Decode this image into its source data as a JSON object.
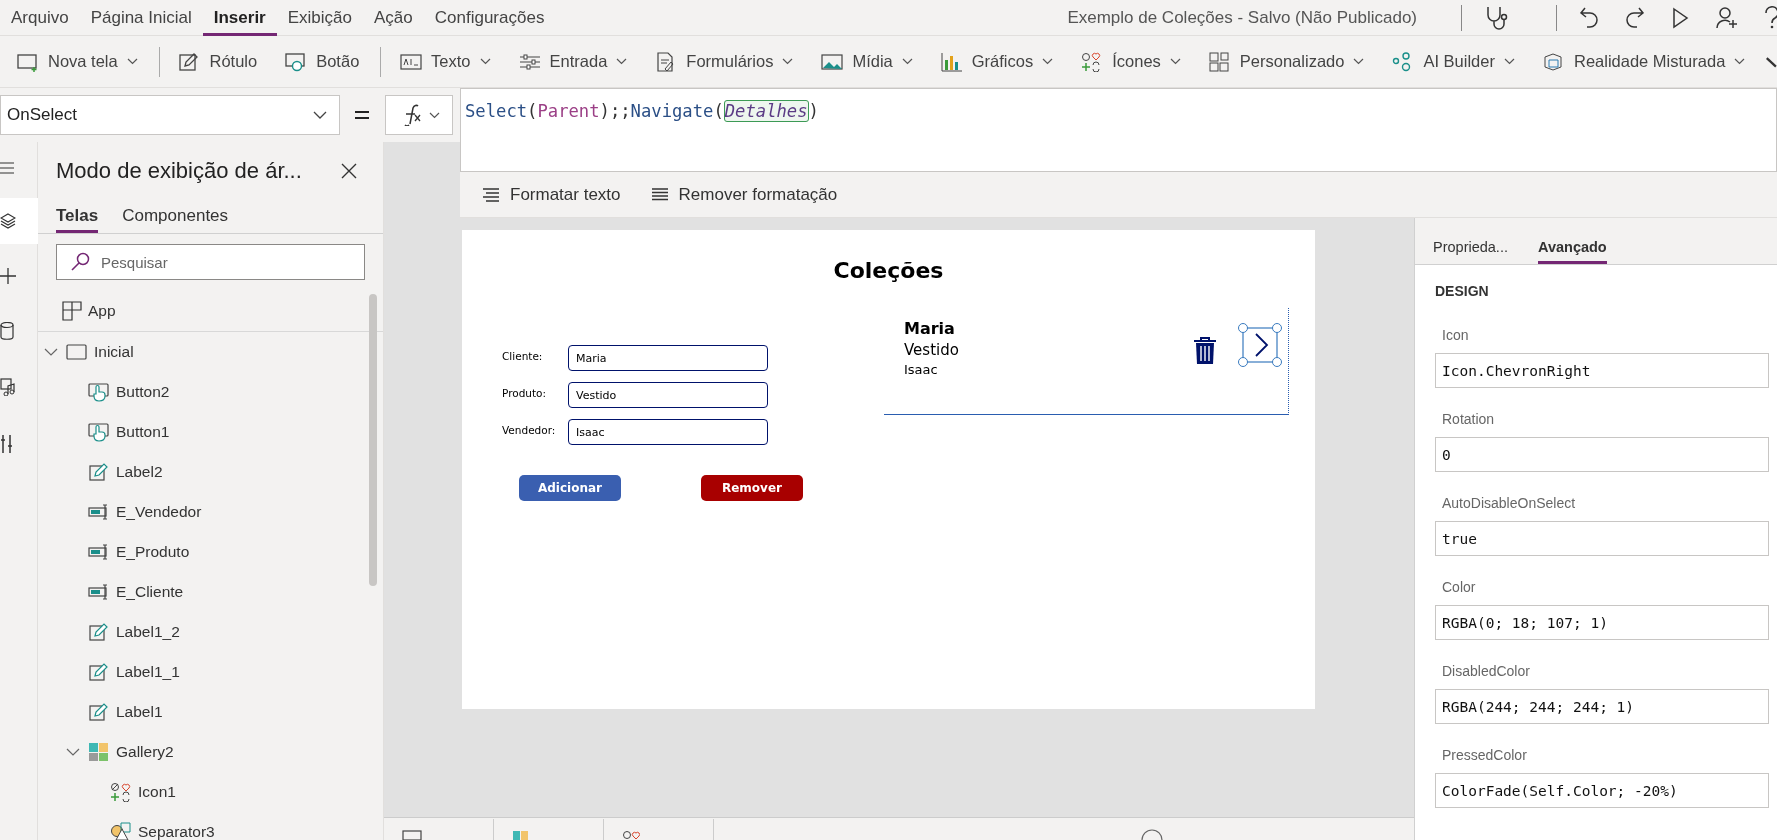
{
  "menu": [
    {
      "label": "Arquivo",
      "selected": false
    },
    {
      "label": "Página Inicial",
      "selected": false
    },
    {
      "label": "Inserir",
      "selected": true
    },
    {
      "label": "Exibição",
      "selected": false
    },
    {
      "label": "Ação",
      "selected": false
    },
    {
      "label": "Configurações",
      "selected": false
    }
  ],
  "document_title": "Exemplo de Coleções - Salvo (Não Publicado)",
  "toolbar": [
    {
      "label": "Nova tela",
      "kind": "new-screen",
      "dropdown": true,
      "divider_after": true
    },
    {
      "label": "Rótulo",
      "kind": "label",
      "dropdown": false,
      "divider_after": false
    },
    {
      "label": "Botão",
      "kind": "button",
      "dropdown": false,
      "divider_after": true
    },
    {
      "label": "Texto",
      "kind": "text",
      "dropdown": true,
      "divider_after": false
    },
    {
      "label": "Entrada",
      "kind": "input",
      "dropdown": true,
      "divider_after": false
    },
    {
      "label": "Formulários",
      "kind": "forms",
      "dropdown": true,
      "divider_after": false
    },
    {
      "label": "Mídia",
      "kind": "media",
      "dropdown": true,
      "divider_after": false
    },
    {
      "label": "Gráficos",
      "kind": "charts",
      "dropdown": true,
      "divider_after": false
    },
    {
      "label": "Ícones",
      "kind": "icons",
      "dropdown": true,
      "divider_after": false
    },
    {
      "label": "Personalizado",
      "kind": "custom",
      "dropdown": true,
      "divider_after": false
    },
    {
      "label": "AI Builder",
      "kind": "ai",
      "dropdown": true,
      "divider_after": false
    },
    {
      "label": "Realidade Misturada",
      "kind": "mixed-reality",
      "dropdown": true,
      "divider_after": false
    }
  ],
  "property": "OnSelect",
  "formula": [
    {
      "text": "Select",
      "kind": "function"
    },
    {
      "text": "(",
      "kind": "punct"
    },
    {
      "text": "Parent",
      "kind": "keyword"
    },
    {
      "text": ");;",
      "kind": "punct"
    },
    {
      "text": "Navigate",
      "kind": "function"
    },
    {
      "text": "(",
      "kind": "punct"
    },
    {
      "text": "Detalhes",
      "kind": "reference"
    },
    {
      "text": ")",
      "kind": "punct"
    }
  ],
  "format_bar": [
    {
      "label": "Formatar texto",
      "kind": "format"
    },
    {
      "label": "Remover formatação",
      "kind": "clear"
    }
  ],
  "tree_panel": {
    "title": "Modo de exibição de ár...",
    "tabs": [
      {
        "label": "Telas",
        "selected": true
      },
      {
        "label": "Componentes",
        "selected": false
      }
    ],
    "search": {
      "placeholder": "Pesquisar"
    },
    "app": {
      "label": "App"
    },
    "screens": [
      {
        "label": "Inicial",
        "kind": "screen",
        "expanded": true,
        "children": [
          {
            "label": "Button2",
            "kind": "button"
          },
          {
            "label": "Button1",
            "kind": "button"
          },
          {
            "label": "Label2",
            "kind": "label"
          },
          {
            "label": "E_Vendedor",
            "kind": "text-input"
          },
          {
            "label": "E_Produto",
            "kind": "text-input"
          },
          {
            "label": "E_Cliente",
            "kind": "text-input"
          },
          {
            "label": "Label1_2",
            "kind": "label"
          },
          {
            "label": "Label1_1",
            "kind": "label"
          },
          {
            "label": "Label1",
            "kind": "label"
          },
          {
            "label": "Gallery2",
            "kind": "gallery",
            "expanded": true,
            "children": [
              {
                "label": "Icon1",
                "kind": "icon"
              },
              {
                "label": "Separator3",
                "kind": "shape"
              }
            ]
          }
        ]
      }
    ]
  },
  "app_screen": {
    "title": "Coleções",
    "fields": [
      {
        "label": "Cliente:",
        "value": "Maria"
      },
      {
        "label": "Produto:",
        "value": "Vestido"
      },
      {
        "label": "Vendedor:",
        "value": "Isaac"
      }
    ],
    "buttons": [
      {
        "label": "Adicionar",
        "color": "#3a5fb0"
      },
      {
        "label": "Remover",
        "color": "#a80000"
      }
    ],
    "gallery": [
      {
        "title": "Maria",
        "subtitle": "Vestido",
        "body": "Isaac"
      }
    ]
  },
  "right_panel": {
    "tabs": [
      {
        "label": "Proprieda...",
        "selected": false
      },
      {
        "label": "Avançado",
        "selected": true
      }
    ],
    "section": "DESIGN",
    "properties": [
      {
        "label": "Icon",
        "value": "Icon.ChevronRight"
      },
      {
        "label": "Rotation",
        "value": "0"
      },
      {
        "label": "AutoDisableOnSelect",
        "value": "true"
      },
      {
        "label": "Color",
        "value": "RGBA(0; 18; 107; 1)"
      },
      {
        "label": "DisabledColor",
        "value": "RGBA(244; 244; 244; 1)"
      },
      {
        "label": "PressedColor",
        "value": "ColorFade(Self.Color; -20%)"
      }
    ]
  }
}
